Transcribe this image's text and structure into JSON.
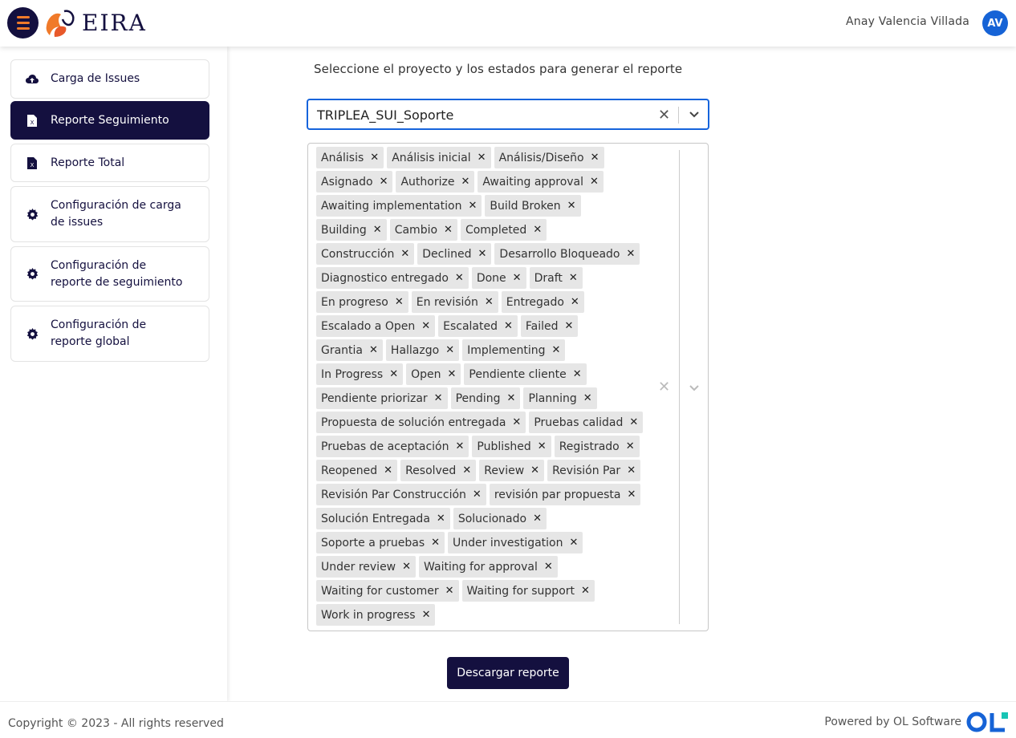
{
  "header": {
    "logo_text": "EIRA",
    "user_name": "Anay Valencia Villada",
    "avatar_initials": "AV",
    "brand_color": "#14103f",
    "accent_color": "#f07a2a"
  },
  "sidebar": {
    "items": [
      {
        "label": "Carga de Issues",
        "icon": "cloud-upload-icon",
        "active": false
      },
      {
        "label": "Reporte Seguimiento",
        "icon": "excel-file-icon",
        "active": true
      },
      {
        "label": "Reporte Total",
        "icon": "excel-file-icon",
        "active": false
      },
      {
        "label_line1": "Configuración de carga",
        "label_line2": "de issues",
        "icon": "gear-icon",
        "active": false
      },
      {
        "label_line1": "Configuración de",
        "label_line2": "reporte de seguimiento",
        "icon": "gear-icon",
        "active": false
      },
      {
        "label_line1": "Configuración de",
        "label_line2": "reporte global",
        "icon": "gear-icon",
        "active": false
      }
    ]
  },
  "main": {
    "prompt": "Seleccione el proyecto y los estados para generar el reporte",
    "project_select": {
      "value": "TRIPLEA_SUI_Soporte"
    },
    "status_rows": [
      [
        "Análisis",
        "Análisis inicial",
        "Análisis/Diseño"
      ],
      [
        "Asignado",
        "Authorize",
        "Awaiting approval"
      ],
      [
        "Awaiting implementation",
        "Build Broken"
      ],
      [
        "Building",
        "Cambio",
        "Completed"
      ],
      [
        "Construcción",
        "Declined",
        "Desarrollo Bloqueado"
      ],
      [
        "Diagnostico entregado",
        "Done",
        "Draft"
      ],
      [
        "En progreso",
        "En revisión",
        "Entregado"
      ],
      [
        "Escalado a Open",
        "Escalated",
        "Failed"
      ],
      [
        "Grantia",
        "Hallazgo",
        "Implementing"
      ],
      [
        "In Progress",
        "Open",
        "Pendiente cliente"
      ],
      [
        "Pendiente priorizar",
        "Pending",
        "Planning"
      ],
      [
        "Propuesta de solución entregada",
        "Pruebas calidad"
      ],
      [
        "Pruebas de aceptación",
        "Published",
        "Registrado"
      ],
      [
        "Reopened",
        "Resolved",
        "Review",
        "Revisión Par"
      ],
      [
        "Revisión Par Construcción",
        "revisión par propuesta"
      ],
      [
        "Solución Entregada",
        "Solucionado"
      ],
      [
        "Soporte a pruebas",
        "Under investigation"
      ],
      [
        "Under review",
        "Waiting for approval"
      ],
      [
        "Waiting for customer",
        "Waiting for support"
      ],
      [
        "Work in progress"
      ]
    ],
    "download_label": "Descargar reporte"
  },
  "footer": {
    "copyright": "Copyright © 2023 - All rights reserved",
    "powered_by": "Powered by OL Software",
    "ol_logo_text": "OL"
  }
}
